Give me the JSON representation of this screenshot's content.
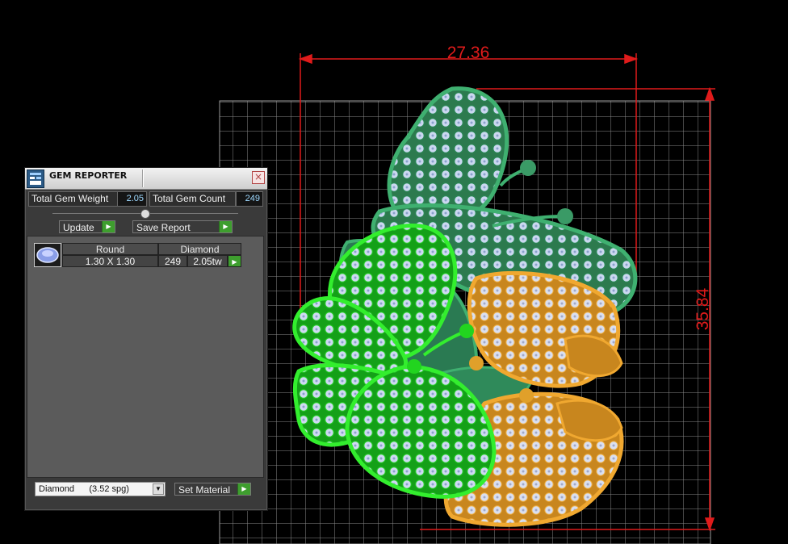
{
  "viewport": {
    "dimension_width": "27.36",
    "dimension_height": "35.84"
  },
  "panel": {
    "title": "GEM REPORTER",
    "close_glyph": "×",
    "total_weight_label": "Total Gem Weight",
    "total_weight_value": "2.05",
    "total_count_label": "Total Gem Count",
    "total_count_value": "249",
    "update_label": "Update",
    "save_report_label": "Save Report",
    "table": {
      "cut_header": "Round",
      "material_header": "Diamond",
      "size": "1.30 X 1.30",
      "count": "249",
      "weight": "2.05tw"
    },
    "material_select_value": "Diamond      (3.52 spg)",
    "set_material_label": "Set Material",
    "arrow_glyph": "▶",
    "caret_glyph": "▼"
  },
  "colors": {
    "dimension_red": "#e01b1b",
    "grid": "#8a8a8a",
    "butterfly_teal": "#3a9a66",
    "butterfly_green": "#22d41f",
    "butterfly_orange": "#e0a02a",
    "gem": "#c6d4f2"
  },
  "icons": [
    "app-icon",
    "close-icon",
    "arrow-right-icon",
    "gem-thumbnail-icon",
    "chevron-down-icon",
    "slider-handle-icon"
  ]
}
